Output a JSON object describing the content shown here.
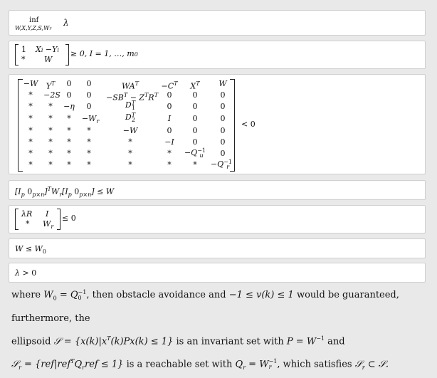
{
  "box1": {
    "op": "inf",
    "sub": "W,X,Y,Z,S,W",
    "subr": "r",
    "var": "λ"
  },
  "box2": {
    "matrix": [
      [
        "1",
        "X",
        "i",
        "−Y",
        "i"
      ],
      [
        "*",
        "W"
      ]
    ],
    "text": "≥ 0, I = 1, …, m",
    "sub": "0"
  },
  "box3": {
    "rows": [
      [
        "−W",
        "Y",
        "T",
        "0",
        "0",
        "WA",
        "T",
        "−C",
        "T",
        "X",
        "T",
        "W"
      ],
      [
        "*",
        "−2S",
        "0",
        "0",
        "−SB",
        "T",
        "− Z",
        "T",
        "R",
        "T",
        "0",
        "0",
        "0"
      ],
      [
        "*",
        "*",
        "−η",
        "0",
        "D",
        "1",
        "T",
        "0",
        "0",
        "0"
      ],
      [
        "*",
        "*",
        "*",
        "−W",
        "r",
        "D",
        "2",
        "T",
        "I",
        "0",
        "0"
      ],
      [
        "*",
        "*",
        "*",
        "*",
        "−W",
        "0",
        "0",
        "0"
      ],
      [
        "*",
        "*",
        "*",
        "*",
        "*",
        "−I",
        "0",
        "0"
      ],
      [
        "*",
        "*",
        "*",
        "*",
        "*",
        "*",
        "−Q",
        "u",
        "−1",
        "0"
      ],
      [
        "*",
        "*",
        "*",
        "*",
        "*",
        "*",
        "*",
        "−Q",
        "r",
        "−1"
      ]
    ],
    "rel": "< 0"
  },
  "box4": {
    "lb": "[I",
    "p": "p",
    "zero": "0",
    "pxn": "p×n",
    "rb": "]",
    "T": "T",
    "W": "W",
    "r": "r",
    "rhs": "≤ W"
  },
  "box5": {
    "a": "λR",
    "b": "I",
    "c": "*",
    "d": "W",
    "dr": "r",
    "rel": "≤ 0"
  },
  "box6": {
    "lhs": "W",
    "rel": "≤",
    "rhs": "W",
    "rsub": "0"
  },
  "box7": {
    "lhs": "λ",
    "rel": ">",
    "rhs": "0"
  },
  "para": {
    "l1a": "where",
    "l1b": "W",
    "l1c": "0",
    "l1d": "= Q",
    "l1e": "0",
    "l1f": "−1",
    "l1g": ", then obstacle avoidance and",
    "l1h": "−1 ≤ v(k) ≤ 1",
    "l1i": "would be guaranteed, furthermore, the",
    "l2a": "ellipsoid",
    "l2b": "𝒮 = {x(k)|x",
    "l2c": "T",
    "l2d": "(k)Px(k) ≤ 1}",
    "l2e": "is an invariant set with",
    "l2f": "P = W",
    "l2g": "−1",
    "l2h": "and",
    "l3a": "𝒮",
    "l3b": "r",
    "l3c": "= {ref|ref",
    "l3d": "T",
    "l3e": "Q",
    "l3f": "r",
    "l3g": "ref ≤ 1}",
    "l3h": "is a reachable set with",
    "l3i": "Q",
    "l3j": "r",
    "l3k": "= W",
    "l3l": "r",
    "l3m": "−1",
    "l3n": ", which satisfies",
    "l3o": "𝒮",
    "l3p": "r",
    "l3q": "⊂ 𝒮."
  }
}
